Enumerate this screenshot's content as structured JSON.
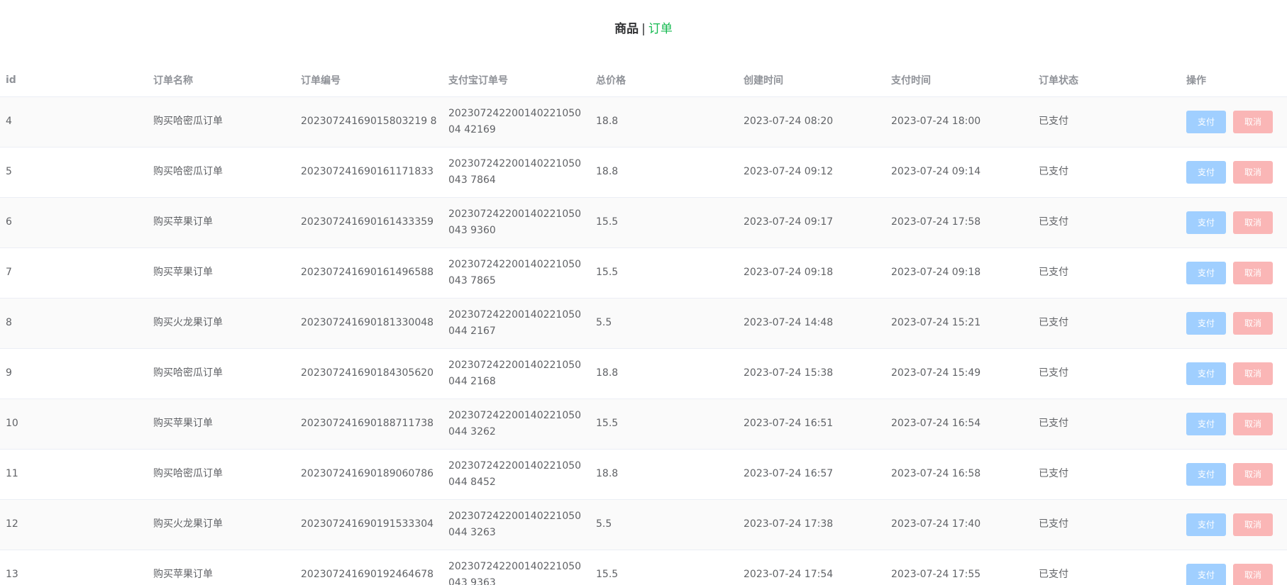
{
  "nav": {
    "goods": "商品",
    "separator": "|",
    "orders": "订单"
  },
  "table": {
    "columns": [
      "id",
      "订单名称",
      "订单编号",
      "支付宝订单号",
      "总价格",
      "创建时间",
      "支付时间",
      "订单状态",
      "操作"
    ],
    "pay_label": "支付",
    "cancel_label": "取消",
    "rows": [
      {
        "id": "4",
        "name": "购买哈密瓜订单",
        "order_no": "20230724169015803219 8",
        "alipay_no": "20230724220014022105004 42169",
        "price": "18.8",
        "created": "2023-07-24 08:20",
        "paid": "2023-07-24 18:00",
        "status": "已支付"
      },
      {
        "id": "5",
        "name": "购买哈密瓜订单",
        "order_no": "202307241690161171833",
        "alipay_no": "202307242200140221050043 7864",
        "price": "18.8",
        "created": "2023-07-24 09:12",
        "paid": "2023-07-24 09:14",
        "status": "已支付"
      },
      {
        "id": "6",
        "name": "购买苹果订单",
        "order_no": "202307241690161433359",
        "alipay_no": "202307242200140221050043 9360",
        "price": "15.5",
        "created": "2023-07-24 09:17",
        "paid": "2023-07-24 17:58",
        "status": "已支付"
      },
      {
        "id": "7",
        "name": "购买苹果订单",
        "order_no": "202307241690161496588",
        "alipay_no": "202307242200140221050043 7865",
        "price": "15.5",
        "created": "2023-07-24 09:18",
        "paid": "2023-07-24 09:18",
        "status": "已支付"
      },
      {
        "id": "8",
        "name": "购买火龙果订单",
        "order_no": "202307241690181330048",
        "alipay_no": "202307242200140221050044 2167",
        "price": "5.5",
        "created": "2023-07-24 14:48",
        "paid": "2023-07-24 15:21",
        "status": "已支付"
      },
      {
        "id": "9",
        "name": "购买哈密瓜订单",
        "order_no": "202307241690184305620",
        "alipay_no": "202307242200140221050044 2168",
        "price": "18.8",
        "created": "2023-07-24 15:38",
        "paid": "2023-07-24 15:49",
        "status": "已支付"
      },
      {
        "id": "10",
        "name": "购买苹果订单",
        "order_no": "202307241690188711738",
        "alipay_no": "202307242200140221050044 3262",
        "price": "15.5",
        "created": "2023-07-24 16:51",
        "paid": "2023-07-24 16:54",
        "status": "已支付"
      },
      {
        "id": "11",
        "name": "购买哈密瓜订单",
        "order_no": "202307241690189060786",
        "alipay_no": "202307242200140221050044 8452",
        "price": "18.8",
        "created": "2023-07-24 16:57",
        "paid": "2023-07-24 16:58",
        "status": "已支付"
      },
      {
        "id": "12",
        "name": "购买火龙果订单",
        "order_no": "202307241690191533304",
        "alipay_no": "202307242200140221050044 3263",
        "price": "5.5",
        "created": "2023-07-24 17:38",
        "paid": "2023-07-24 17:40",
        "status": "已支付"
      },
      {
        "id": "13",
        "name": "购买苹果订单",
        "order_no": "202307241690192464678",
        "alipay_no": "202307242200140221050043 9363",
        "price": "15.5",
        "created": "2023-07-24 17:54",
        "paid": "2023-07-24 17:55",
        "status": "已支付"
      }
    ]
  }
}
